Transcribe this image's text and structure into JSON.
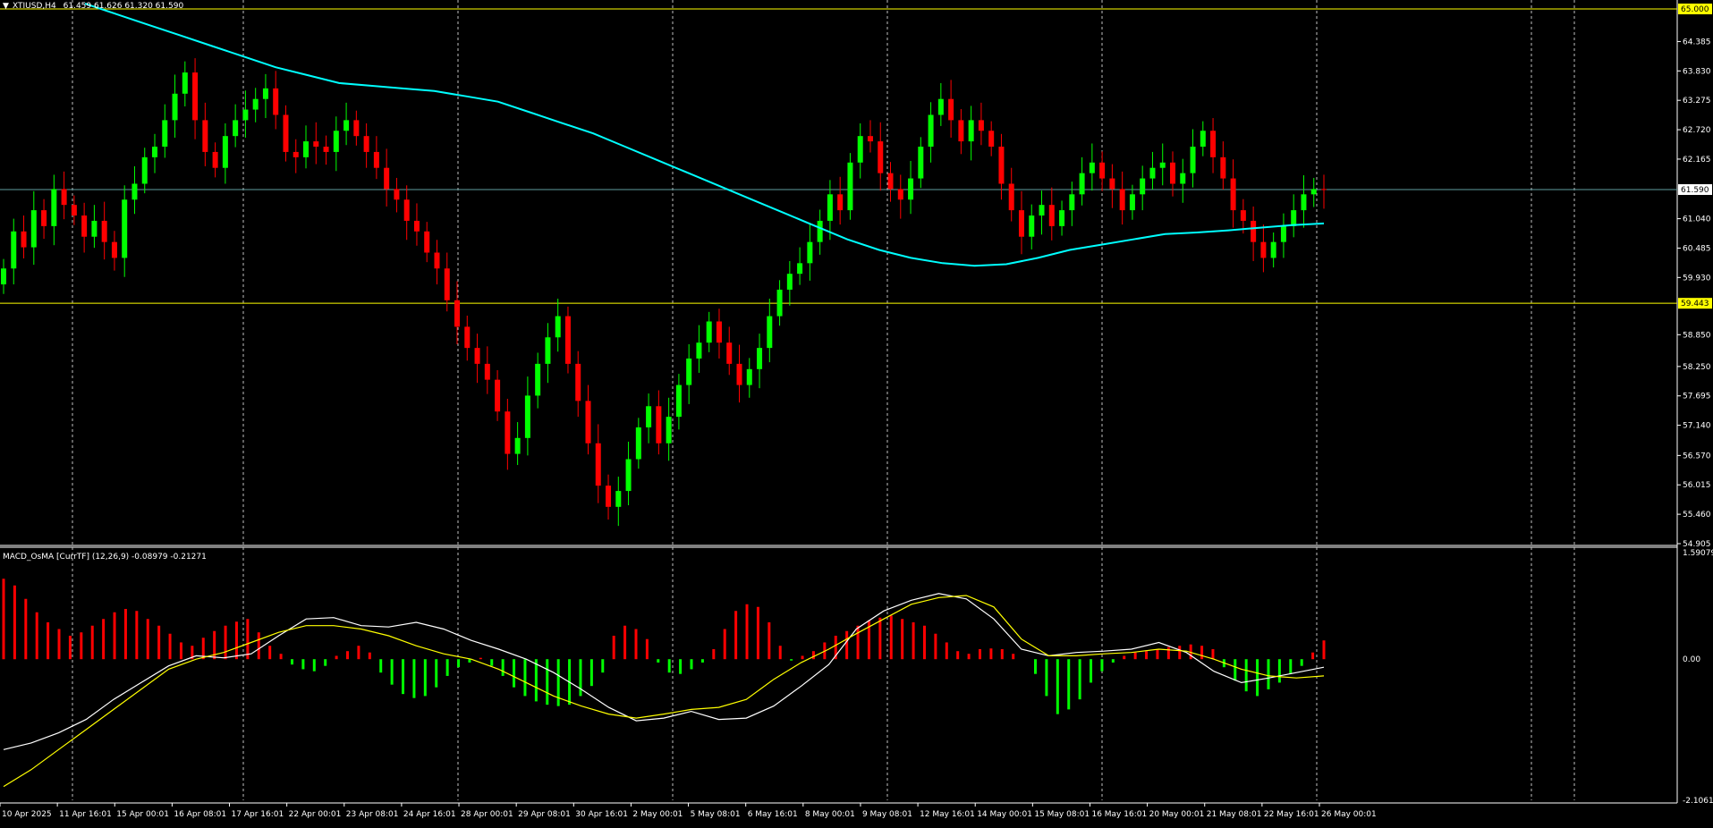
{
  "symbol_header": "XTIUSD,H4",
  "ohlc_text": "61.459 61.626 61.320 61.590",
  "indicator_header": "MACD_OsMA [CurrTF] (12,26,9) -0.08979 -0.21271",
  "colors": {
    "background": "#000000",
    "bull_candle": "#00ff00",
    "bear_candle": "#ff0000",
    "ma_line": "#00ffff",
    "hline": "#ffff00",
    "current_price_line": "#5f9ea0",
    "grid": "#c0c0c0",
    "macd_line": "#ffffff",
    "signal_line": "#ffff00",
    "hist_pos": "#ff0000",
    "hist_neg": "#00ff00"
  },
  "chart_data": [
    {
      "type": "candlestick",
      "title": "XTIUSD,H4",
      "ylim": [
        54.905,
        65.0
      ],
      "y_ticks": [
        "64.385",
        "63.830",
        "63.275",
        "62.720",
        "62.165",
        "61.040",
        "60.485",
        "59.930",
        "58.850",
        "58.250",
        "57.695",
        "57.140",
        "56.570",
        "56.015",
        "55.460",
        "54.905"
      ],
      "price_labels": [
        {
          "value": 65.0,
          "label": "65.000",
          "kind": "hline"
        },
        {
          "value": 61.59,
          "label": "61.590",
          "kind": "current"
        },
        {
          "value": 59.443,
          "label": "59.443",
          "kind": "hline"
        }
      ],
      "time_labels": [
        "10 Apr 2025",
        "11 Apr 16:01",
        "15 Apr 00:01",
        "16 Apr 08:01",
        "17 Apr 16:01",
        "22 Apr 00:01",
        "23 Apr 08:01",
        "24 Apr 16:01",
        "28 Apr 00:01",
        "29 Apr 08:01",
        "30 Apr 16:01",
        "2 May 00:01",
        "5 May 08:01",
        "6 May 16:01",
        "8 May 00:01",
        "9 May 08:01",
        "12 May 16:01",
        "14 May 00:01",
        "15 May 08:01",
        "16 May 16:01",
        "20 May 00:01",
        "21 May 08:01",
        "22 May 16:01",
        "26 May 00:01"
      ],
      "series": [
        {
          "name": "XTIUSD,H4",
          "close": [
            60.1,
            60.8,
            60.5,
            61.2,
            60.9,
            61.6,
            61.3,
            61.1,
            60.7,
            61.0,
            60.6,
            60.3,
            61.4,
            61.7,
            62.2,
            62.4,
            62.9,
            63.4,
            63.8,
            62.9,
            62.3,
            62.0,
            62.6,
            62.9,
            63.1,
            63.3,
            63.5,
            63.0,
            62.3,
            62.2,
            62.5,
            62.4,
            62.3,
            62.7,
            62.9,
            62.6,
            62.3,
            62.0,
            61.6,
            61.4,
            61.0,
            60.8,
            60.4,
            60.1,
            59.5,
            59.0,
            58.6,
            58.3,
            58.0,
            57.4,
            56.6,
            56.9,
            57.7,
            58.3,
            58.8,
            59.2,
            58.3,
            57.6,
            56.8,
            56.0,
            55.6,
            55.9,
            56.5,
            57.1,
            57.5,
            56.8,
            57.3,
            57.9,
            58.4,
            58.7,
            59.1,
            58.7,
            58.3,
            57.9,
            58.2,
            58.6,
            59.2,
            59.7,
            60.0,
            60.2,
            60.6,
            61.0,
            61.5,
            61.2,
            62.1,
            62.6,
            62.5,
            61.9,
            61.6,
            61.4,
            61.8,
            62.4,
            63.0,
            63.3,
            62.9,
            62.5,
            62.9,
            62.7,
            62.4,
            61.7,
            61.2,
            60.7,
            61.1,
            61.3,
            60.9,
            61.2,
            61.5,
            61.9,
            62.1,
            61.8,
            61.6,
            61.2,
            61.5,
            61.8,
            62.0,
            62.1,
            61.7,
            61.9,
            62.4,
            62.7,
            62.2,
            61.8,
            61.2,
            61.0,
            60.6,
            60.3,
            60.6,
            60.9,
            61.2,
            61.5,
            61.6,
            61.59
          ]
        }
      ],
      "ma_name": "",
      "ma_values": [
        65.1,
        64.9,
        64.7,
        64.5,
        64.3,
        64.1,
        63.9,
        63.75,
        63.6,
        63.55,
        63.5,
        63.45,
        63.35,
        63.25,
        63.05,
        62.85,
        62.65,
        62.4,
        62.15,
        61.9,
        61.65,
        61.4,
        61.15,
        60.9,
        60.65,
        60.45,
        60.3,
        60.2,
        60.15,
        60.18,
        60.3,
        60.45,
        60.55,
        60.65,
        60.75,
        60.78,
        60.82,
        60.87,
        60.92,
        60.95
      ]
    },
    {
      "type": "bar+line",
      "title": "MACD_OsMA [CurrTF] (12,26,9) -0.08979 -0.21271",
      "ylim": [
        -2.1061,
        1.59079
      ],
      "y_ticks": [
        "1.59079",
        "0.00",
        "-2.1061"
      ],
      "histogram": [
        1.2,
        1.1,
        0.9,
        0.7,
        0.55,
        0.45,
        0.35,
        0.4,
        0.5,
        0.6,
        0.7,
        0.75,
        0.72,
        0.6,
        0.5,
        0.38,
        0.25,
        0.2,
        0.32,
        0.42,
        0.5,
        0.56,
        0.6,
        0.4,
        0.2,
        0.08,
        -0.08,
        -0.15,
        -0.18,
        -0.1,
        0.05,
        0.12,
        0.2,
        0.1,
        -0.2,
        -0.38,
        -0.52,
        -0.58,
        -0.55,
        -0.42,
        -0.25,
        -0.12,
        -0.05,
        0.02,
        -0.1,
        -0.25,
        -0.42,
        -0.55,
        -0.63,
        -0.68,
        -0.7,
        -0.68,
        -0.55,
        -0.4,
        -0.2,
        0.35,
        0.5,
        0.45,
        0.3,
        -0.05,
        -0.2,
        -0.22,
        -0.15,
        -0.05,
        0.15,
        0.45,
        0.72,
        0.82,
        0.78,
        0.55,
        0.2,
        -0.02,
        0.05,
        0.12,
        0.25,
        0.35,
        0.42,
        0.5,
        0.58,
        0.62,
        0.65,
        0.6,
        0.55,
        0.5,
        0.38,
        0.25,
        0.12,
        0.08,
        0.15,
        0.16,
        0.15,
        0.08,
        0.0,
        -0.22,
        -0.55,
        -0.82,
        -0.75,
        -0.6,
        -0.35,
        -0.18,
        -0.05,
        0.05,
        0.1,
        0.12,
        0.15,
        0.18,
        0.2,
        0.22,
        0.2,
        0.15,
        -0.12,
        -0.32,
        -0.48,
        -0.55,
        -0.45,
        -0.35,
        -0.22,
        -0.1,
        0.1,
        0.28
      ],
      "series": [
        {
          "name": "",
          "values": [
            -1.35,
            -1.25,
            -1.1,
            -0.9,
            -0.6,
            -0.35,
            -0.1,
            0.05,
            0.02,
            0.08,
            0.35,
            0.6,
            0.62,
            0.5,
            0.48,
            0.55,
            0.45,
            0.28,
            0.15,
            0.0,
            -0.2,
            -0.45,
            -0.72,
            -0.92,
            -0.88,
            -0.78,
            -0.9,
            -0.88,
            -0.7,
            -0.4,
            -0.08,
            0.45,
            0.72,
            0.88,
            0.98,
            0.9,
            0.6,
            0.15,
            0.05,
            0.1,
            0.12,
            0.15,
            0.25,
            0.1,
            -0.18,
            -0.35,
            -0.28,
            -0.2,
            -0.12
          ]
        },
        {
          "name": "",
          "values": [
            -1.9,
            -1.65,
            -1.35,
            -1.05,
            -0.75,
            -0.45,
            -0.15,
            0.0,
            0.1,
            0.25,
            0.4,
            0.5,
            0.5,
            0.45,
            0.35,
            0.2,
            0.08,
            0.0,
            -0.15,
            -0.35,
            -0.55,
            -0.7,
            -0.82,
            -0.88,
            -0.82,
            -0.75,
            -0.72,
            -0.6,
            -0.3,
            -0.05,
            0.15,
            0.38,
            0.6,
            0.82,
            0.92,
            0.95,
            0.78,
            0.3,
            0.05,
            0.05,
            0.08,
            0.1,
            0.15,
            0.12,
            0.0,
            -0.15,
            -0.25,
            -0.28,
            -0.25
          ]
        }
      ]
    }
  ]
}
